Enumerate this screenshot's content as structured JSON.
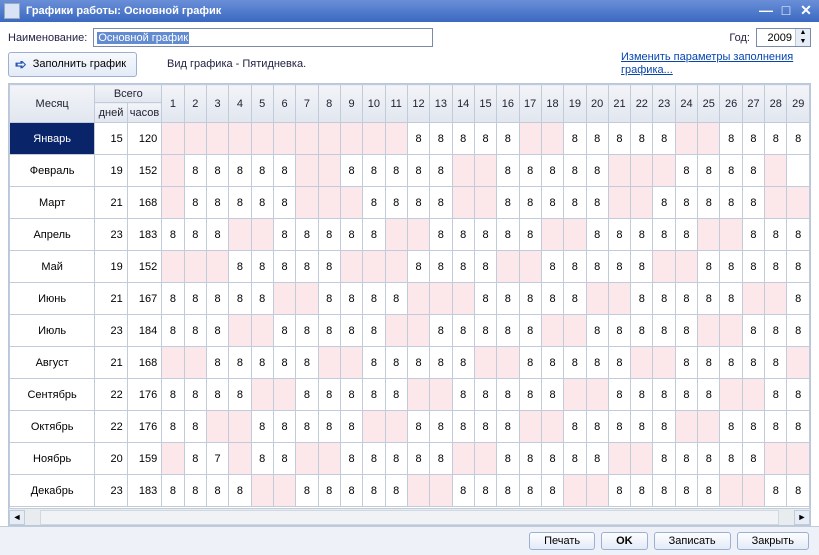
{
  "window": {
    "title": "Графики работы: Основной график"
  },
  "labels": {
    "name": "Наименование:",
    "year": "Год:",
    "fill": "Заполнить график",
    "view_type": "Вид графика - Пятидневка.",
    "change_params": "Изменить параметры заполнения графика..."
  },
  "fields": {
    "name_value": "Основной график",
    "year_value": "2009"
  },
  "header": {
    "month": "Месяц",
    "total": "Всего",
    "days_sub": "дней",
    "hours_sub": "часов"
  },
  "buttons": {
    "print": "Печать",
    "ok": "OK",
    "save": "Записать",
    "close": "Закрыть"
  },
  "days_shown": [
    1,
    2,
    3,
    4,
    5,
    6,
    7,
    8,
    9,
    10,
    11,
    12,
    13,
    14,
    15,
    16,
    17,
    18,
    19,
    20,
    21,
    22,
    23,
    24,
    25,
    26,
    27,
    28,
    29
  ],
  "months": [
    {
      "name": "Январь",
      "selected": true,
      "days": 15,
      "hours": 120,
      "cells": {
        "1": "w",
        "2": "w",
        "3": "w",
        "4": "w",
        "5": "w",
        "6": "w",
        "7": "w",
        "8": "w",
        "9": "w",
        "10": "w",
        "11": "w",
        "12": "8",
        "13": "8",
        "14": "8",
        "15": "8",
        "16": "8",
        "17": "w",
        "18": "w",
        "19": "8",
        "20": "8",
        "21": "8",
        "22": "8",
        "23": "8",
        "24": "w",
        "25": "w",
        "26": "8",
        "27": "8",
        "28": "8",
        "29": "8"
      }
    },
    {
      "name": "Февраль",
      "days": 19,
      "hours": 152,
      "cells": {
        "1": "w",
        "2": "8",
        "3": "8",
        "4": "8",
        "5": "8",
        "6": "8",
        "7": "w",
        "8": "w",
        "9": "8",
        "10": "8",
        "11": "8",
        "12": "8",
        "13": "8",
        "14": "w",
        "15": "w",
        "16": "8",
        "17": "8",
        "18": "8",
        "19": "8",
        "20": "8",
        "21": "w",
        "22": "w",
        "23": "w",
        "24": "8",
        "25": "8",
        "26": "8",
        "27": "8",
        "28": "w"
      }
    },
    {
      "name": "Март",
      "days": 21,
      "hours": 168,
      "cells": {
        "1": "w",
        "2": "8",
        "3": "8",
        "4": "8",
        "5": "8",
        "6": "8",
        "7": "w",
        "8": "w",
        "9": "w",
        "10": "8",
        "11": "8",
        "12": "8",
        "13": "8",
        "14": "w",
        "15": "w",
        "16": "8",
        "17": "8",
        "18": "8",
        "19": "8",
        "20": "8",
        "21": "w",
        "22": "w",
        "23": "8",
        "24": "8",
        "25": "8",
        "26": "8",
        "27": "8",
        "28": "w",
        "29": "w"
      }
    },
    {
      "name": "Апрель",
      "days": 23,
      "hours": 183,
      "cells": {
        "1": "8",
        "2": "8",
        "3": "8",
        "4": "w",
        "5": "w",
        "6": "8",
        "7": "8",
        "8": "8",
        "9": "8",
        "10": "8",
        "11": "w",
        "12": "w",
        "13": "8",
        "14": "8",
        "15": "8",
        "16": "8",
        "17": "8",
        "18": "w",
        "19": "w",
        "20": "8",
        "21": "8",
        "22": "8",
        "23": "8",
        "24": "8",
        "25": "w",
        "26": "w",
        "27": "8",
        "28": "8",
        "29": "8"
      }
    },
    {
      "name": "Май",
      "days": 19,
      "hours": 152,
      "cells": {
        "1": "w",
        "2": "w",
        "3": "w",
        "4": "8",
        "5": "8",
        "6": "8",
        "7": "8",
        "8": "8",
        "9": "w",
        "10": "w",
        "11": "w",
        "12": "8",
        "13": "8",
        "14": "8",
        "15": "8",
        "16": "w",
        "17": "w",
        "18": "8",
        "19": "8",
        "20": "8",
        "21": "8",
        "22": "8",
        "23": "w",
        "24": "w",
        "25": "8",
        "26": "8",
        "27": "8",
        "28": "8",
        "29": "8"
      }
    },
    {
      "name": "Июнь",
      "days": 21,
      "hours": 167,
      "cells": {
        "1": "8",
        "2": "8",
        "3": "8",
        "4": "8",
        "5": "8",
        "6": "w",
        "7": "w",
        "8": "8",
        "9": "8",
        "10": "8",
        "11": "8",
        "12": "w",
        "13": "w",
        "14": "w",
        "15": "8",
        "16": "8",
        "17": "8",
        "18": "8",
        "19": "8",
        "20": "w",
        "21": "w",
        "22": "8",
        "23": "8",
        "24": "8",
        "25": "8",
        "26": "8",
        "27": "w",
        "28": "w",
        "29": "8"
      }
    },
    {
      "name": "Июль",
      "days": 23,
      "hours": 184,
      "cells": {
        "1": "8",
        "2": "8",
        "3": "8",
        "4": "w",
        "5": "w",
        "6": "8",
        "7": "8",
        "8": "8",
        "9": "8",
        "10": "8",
        "11": "w",
        "12": "w",
        "13": "8",
        "14": "8",
        "15": "8",
        "16": "8",
        "17": "8",
        "18": "w",
        "19": "w",
        "20": "8",
        "21": "8",
        "22": "8",
        "23": "8",
        "24": "8",
        "25": "w",
        "26": "w",
        "27": "8",
        "28": "8",
        "29": "8"
      }
    },
    {
      "name": "Август",
      "days": 21,
      "hours": 168,
      "cells": {
        "1": "w",
        "2": "w",
        "3": "8",
        "4": "8",
        "5": "8",
        "6": "8",
        "7": "8",
        "8": "w",
        "9": "w",
        "10": "8",
        "11": "8",
        "12": "8",
        "13": "8",
        "14": "8",
        "15": "w",
        "16": "w",
        "17": "8",
        "18": "8",
        "19": "8",
        "20": "8",
        "21": "8",
        "22": "w",
        "23": "w",
        "24": "8",
        "25": "8",
        "26": "8",
        "27": "8",
        "28": "8",
        "29": "w"
      }
    },
    {
      "name": "Сентябрь",
      "days": 22,
      "hours": 176,
      "cells": {
        "1": "8",
        "2": "8",
        "3": "8",
        "4": "8",
        "5": "w",
        "6": "w",
        "7": "8",
        "8": "8",
        "9": "8",
        "10": "8",
        "11": "8",
        "12": "w",
        "13": "w",
        "14": "8",
        "15": "8",
        "16": "8",
        "17": "8",
        "18": "8",
        "19": "w",
        "20": "w",
        "21": "8",
        "22": "8",
        "23": "8",
        "24": "8",
        "25": "8",
        "26": "w",
        "27": "w",
        "28": "8",
        "29": "8"
      }
    },
    {
      "name": "Октябрь",
      "days": 22,
      "hours": 176,
      "cells": {
        "1": "8",
        "2": "8",
        "3": "w",
        "4": "w",
        "5": "8",
        "6": "8",
        "7": "8",
        "8": "8",
        "9": "8",
        "10": "w",
        "11": "w",
        "12": "8",
        "13": "8",
        "14": "8",
        "15": "8",
        "16": "8",
        "17": "w",
        "18": "w",
        "19": "8",
        "20": "8",
        "21": "8",
        "22": "8",
        "23": "8",
        "24": "w",
        "25": "w",
        "26": "8",
        "27": "8",
        "28": "8",
        "29": "8"
      }
    },
    {
      "name": "Ноябрь",
      "days": 20,
      "hours": 159,
      "cells": {
        "1": "w",
        "2": "8",
        "3": "7",
        "4": "w",
        "5": "8",
        "6": "8",
        "7": "w",
        "8": "w",
        "9": "8",
        "10": "8",
        "11": "8",
        "12": "8",
        "13": "8",
        "14": "w",
        "15": "w",
        "16": "8",
        "17": "8",
        "18": "8",
        "19": "8",
        "20": "8",
        "21": "w",
        "22": "w",
        "23": "8",
        "24": "8",
        "25": "8",
        "26": "8",
        "27": "8",
        "28": "w",
        "29": "w"
      }
    },
    {
      "name": "Декабрь",
      "days": 23,
      "hours": 183,
      "cells": {
        "1": "8",
        "2": "8",
        "3": "8",
        "4": "8",
        "5": "w",
        "6": "w",
        "7": "8",
        "8": "8",
        "9": "8",
        "10": "8",
        "11": "8",
        "12": "w",
        "13": "w",
        "14": "8",
        "15": "8",
        "16": "8",
        "17": "8",
        "18": "8",
        "19": "w",
        "20": "w",
        "21": "8",
        "22": "8",
        "23": "8",
        "24": "8",
        "25": "8",
        "26": "w",
        "27": "w",
        "28": "8",
        "29": "8"
      }
    }
  ]
}
